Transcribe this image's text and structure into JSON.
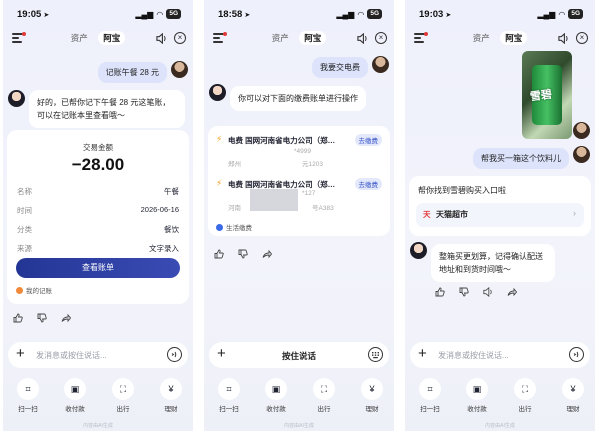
{
  "common": {
    "tab_assets": "资产",
    "tab_active": "阿宝",
    "input_placeholder": "发消息或按住说话...",
    "hold_to_talk": "按住说话",
    "quick_actions": [
      "扫一扫",
      "收付款",
      "出行",
      "理财"
    ],
    "watermark": "内容由AI生成",
    "battery": "5G",
    "accent_color": "#2b3a9e"
  },
  "screen1": {
    "time": "19:05",
    "user_msg": "记账午餐 28 元",
    "ai_msg": "好的，已帮你记下午餐 28 元这笔账，可以在记账本里查看哦～",
    "card": {
      "amount_label": "交易金额",
      "amount": "−28.00",
      "rows": [
        {
          "label": "名称",
          "value": "午餐"
        },
        {
          "label": "时间",
          "value": "2026-06-16"
        },
        {
          "label": "分类",
          "value": "餐饮"
        },
        {
          "label": "来源",
          "value": "文字录入"
        }
      ],
      "button": "查看账单",
      "footer": "我的记账"
    }
  },
  "screen2": {
    "time": "18:58",
    "user_msg": "我要交电费",
    "ai_msg": "你可以对下面的缴费账单进行操作",
    "bills": [
      {
        "title": "电费  国网河南省电力公司（郑…",
        "pay": "去缴费",
        "line1": "*4999",
        "line2a": "郑州",
        "line2b": "元1203"
      },
      {
        "title": "电费  国网河南省电力公司（郑…",
        "pay": "去缴费",
        "line1": "*127",
        "line2a": "河南",
        "line2b": "号A383"
      }
    ],
    "footer": "生活缴费"
  },
  "screen3": {
    "time": "19:03",
    "user_msg": "帮我买一箱这个饮料儿",
    "result_title": "帮你找到雪碧购买入口啦",
    "store_icon": "天",
    "store_name": "天猫超市",
    "ai_msg": "整箱买更划算，记得确认配送地址和到货时间哦～",
    "photo_text": "雪碧"
  }
}
